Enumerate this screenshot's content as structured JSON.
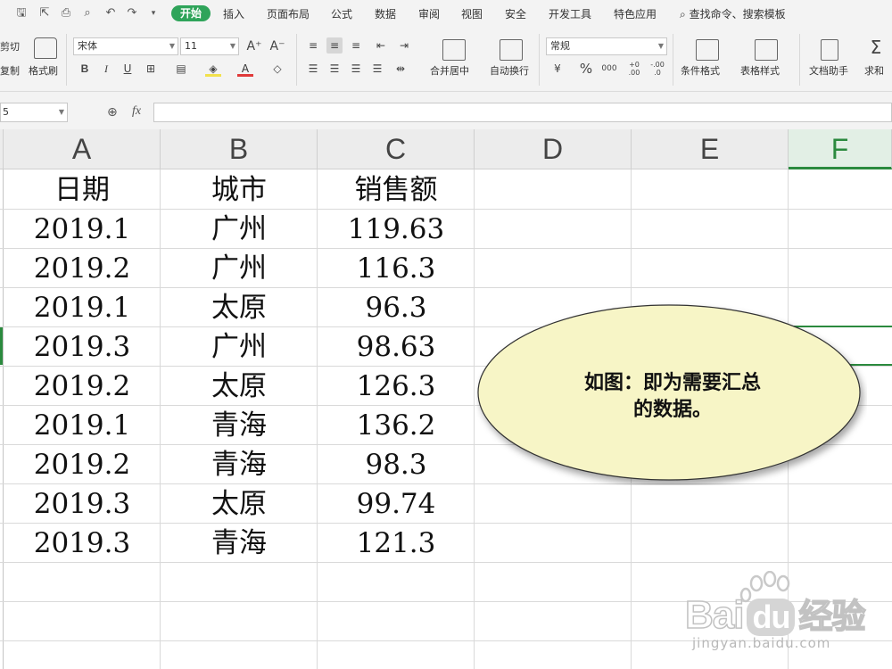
{
  "tabs": {
    "items": [
      "开始",
      "插入",
      "页面布局",
      "公式",
      "数据",
      "审阅",
      "视图",
      "安全",
      "开发工具",
      "特色应用"
    ],
    "search_label": "查找命令、搜索模板"
  },
  "ribbon": {
    "cut": "剪切",
    "copy": "复制",
    "format_painter": "格式刷",
    "font_name": "宋体",
    "font_size": "11",
    "bold": "B",
    "italic": "I",
    "underline": "U",
    "merge_center": "合并居中",
    "wrap_text": "自动换行",
    "number_format": "常规",
    "percent": "%",
    "thousands": "000",
    "inc_decimal": "+0 .00",
    "dec_decimal": "-.00 .0",
    "cond_format": "条件格式",
    "table_style": "表格样式",
    "doc_assistant": "文档助手",
    "sum": "求和"
  },
  "formula_bar": {
    "name_box": "5",
    "fx": "fx",
    "value": ""
  },
  "sheet": {
    "columns": [
      "A",
      "B",
      "C",
      "D",
      "E",
      "F"
    ],
    "headers": [
      "日期",
      "城市",
      "销售额"
    ],
    "rows": [
      [
        "2019.1",
        "广州",
        "119.63"
      ],
      [
        "2019.2",
        "广州",
        "116.3"
      ],
      [
        "2019.1",
        "太原",
        "96.3"
      ],
      [
        "2019.3",
        "广州",
        "98.63"
      ],
      [
        "2019.2",
        "太原",
        "126.3"
      ],
      [
        "2019.1",
        "青海",
        "136.2"
      ],
      [
        "2019.2",
        "青海",
        "98.3"
      ],
      [
        "2019.3",
        "太原",
        "99.74"
      ],
      [
        "2019.3",
        "青海",
        "121.3"
      ]
    ]
  },
  "callout": {
    "line1": "如图：即为需要汇总",
    "line2": "的数据。",
    "fill": "#f7f5c6"
  },
  "watermark": {
    "brand": "Bai",
    "brand2": "du",
    "cn": "经验",
    "url": "jingyan.baidu.com"
  },
  "colors": {
    "accent": "#2fa45a",
    "selected_column": "#2b8a3e"
  }
}
